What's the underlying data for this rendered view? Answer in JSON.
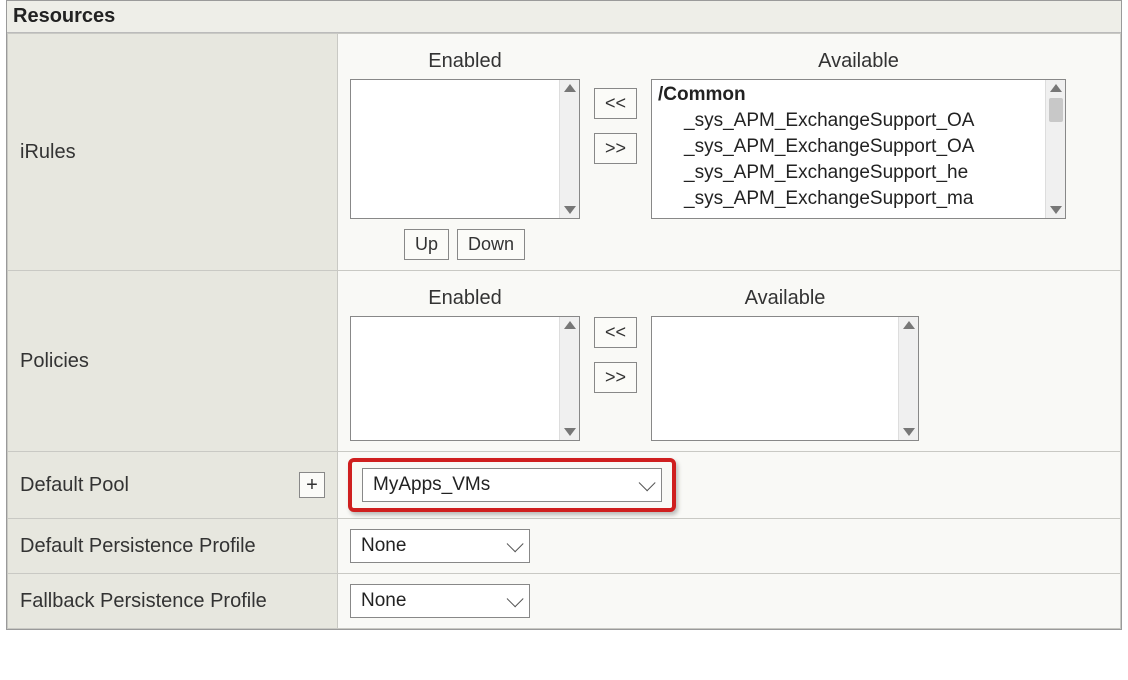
{
  "panel": {
    "title": "Resources"
  },
  "irules": {
    "label": "iRules",
    "enabled_header": "Enabled",
    "available_header": "Available",
    "move_left": "<<",
    "move_right": ">>",
    "up_label": "Up",
    "down_label": "Down",
    "available_group": "/Common",
    "available_items": [
      "_sys_APM_ExchangeSupport_OA",
      "_sys_APM_ExchangeSupport_OA",
      "_sys_APM_ExchangeSupport_he",
      "_sys_APM_ExchangeSupport_ma"
    ]
  },
  "policies": {
    "label": "Policies",
    "enabled_header": "Enabled",
    "available_header": "Available",
    "move_left": "<<",
    "move_right": ">>"
  },
  "default_pool": {
    "label": "Default Pool",
    "plus_label": "+",
    "value": "MyApps_VMs"
  },
  "default_persistence": {
    "label": "Default Persistence Profile",
    "value": "None"
  },
  "fallback_persistence": {
    "label": "Fallback Persistence Profile",
    "value": "None"
  }
}
